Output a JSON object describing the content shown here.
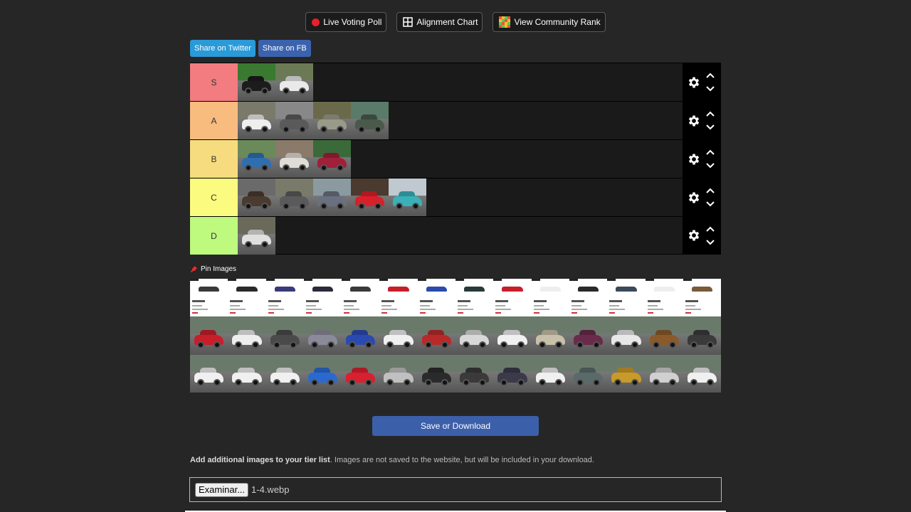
{
  "topbar": {
    "live_poll": "Live Voting Poll",
    "alignment_chart": "Alignment Chart",
    "community_rank": "View Community Rank"
  },
  "share": {
    "twitter": "Share on Twitter",
    "facebook": "Share on FB"
  },
  "tiers": [
    {
      "label": "S",
      "color": "#f27c7f",
      "items": [
        [
          "#1c1c1c",
          "#3a7a30"
        ],
        [
          "#e9e9e9",
          "#6b7a55"
        ]
      ]
    },
    {
      "label": "A",
      "color": "#f8bc7f",
      "items": [
        [
          "#eeeeee",
          "#7a7a6a"
        ],
        [
          "#5a5a5a",
          "#888888"
        ],
        [
          "#9a9a8a",
          "#6a6a4a"
        ],
        [
          "#4a5a4a",
          "#5a7a6a"
        ]
      ]
    },
    {
      "label": "B",
      "color": "#f7dc7f",
      "items": [
        [
          "#2f6fb0",
          "#6a8a5a"
        ],
        [
          "#e0dcd8",
          "#8a7a6a"
        ],
        [
          "#a0203a",
          "#3a6a3a"
        ]
      ]
    },
    {
      "label": "C",
      "color": "#fbfb7f",
      "items": [
        [
          "#4a3a30",
          "#6a6a6a"
        ],
        [
          "#5a5a5a",
          "#7a7a6a"
        ],
        [
          "#6a7080",
          "#8a9aa0"
        ],
        [
          "#d8202a",
          "#4a3a30"
        ],
        [
          "#3ab0b8",
          "#c0c8d0"
        ]
      ]
    },
    {
      "label": "D",
      "color": "#bdfa7e",
      "items": [
        [
          "#e0e0e0",
          "#6a6a5a"
        ]
      ]
    }
  ],
  "pin_images_label": "Pin Images",
  "pool": {
    "cards": [
      "#3a3a3a",
      "#2a2a2a",
      "#3a3a7a",
      "#2a2a3a",
      "#3a3a3a",
      "#c81e2a",
      "#2a4ab0",
      "#2a3a3a",
      "#c81e2a",
      "#eeeeee",
      "#2a2a2a",
      "#3a4a5a",
      "#eeeeee",
      "#7a5a3a"
    ],
    "photos": [
      [
        "#c81e2a",
        "#eeeeee",
        "#4a4a4a",
        "#8a8a9a",
        "#2a4ab0",
        "#f0f0f0",
        "#b82a2a",
        "#d8d8d8",
        "#f0f0f0",
        "#c8c0a8",
        "#6a2a4a",
        "#e8e8e8",
        "#8a5a2a",
        "#3a3a3a"
      ],
      [
        "#f0f0f0",
        "#f0f0f0",
        "#f0f0f0",
        "#2a6ad0",
        "#d82030",
        "#c0c0c0",
        "#2a2a2a",
        "#3a3a3a",
        "#3a3a4a",
        "#f0f0f0",
        "#5a6a6a",
        "#c89a2a",
        "#d0d0d0",
        "#f0f0f0"
      ]
    ]
  },
  "save_button": "Save or Download",
  "add_info": {
    "bold": "Add additional images to your tier list",
    "rest": ". Images are not saved to the website, but will be included in your download."
  },
  "file_input": {
    "button": "Examinar...",
    "filename": "1-4.webp"
  }
}
